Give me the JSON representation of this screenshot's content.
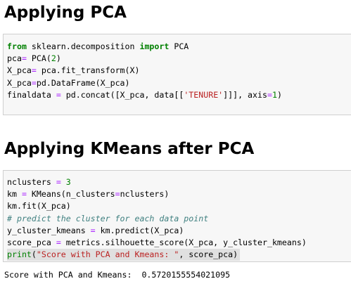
{
  "sections": [
    {
      "heading": "Applying PCA"
    },
    {
      "heading": "Applying KMeans after PCA"
    }
  ],
  "cell1": {
    "line1": {
      "a": "from",
      "b": " sklearn.decomposition ",
      "c": "import",
      "d": " PCA"
    },
    "line2": {
      "a": "pca",
      "b": "=",
      "c": " PCA(",
      "d": "2",
      "e": ")"
    },
    "line3": {
      "a": "X_pca",
      "b": "=",
      "c": " pca.fit_transform(X)"
    },
    "line4": {
      "a": "X_pca",
      "b": "=",
      "c": "pd.DataFrame(X_pca)"
    },
    "line5": {
      "a": "finaldata ",
      "b": "=",
      "c": " pd.concat([X_pca, data[[",
      "d": "'TENURE'",
      "e": "]]], axis",
      "f": "=",
      "g": "1",
      "h": ")"
    }
  },
  "cell2": {
    "line1": {
      "a": "nclusters ",
      "b": "=",
      "c": " ",
      "d": "3"
    },
    "line2": {
      "a": "km ",
      "b": "=",
      "c": " KMeans(n_clusters",
      "d": "=",
      "e": "nclusters)"
    },
    "line3": {
      "a": "km.fit(X_pca)"
    },
    "line4": {
      "a": "# predict the cluster for each data point"
    },
    "line5": {
      "a": "y_cluster_kmeans ",
      "b": "=",
      "c": " km.predict(X_pca)"
    },
    "line6": {
      "a": "score_pca ",
      "b": "=",
      "c": " metrics.silhouette_score(X_pca, y_cluster_kmeans)"
    },
    "line7": {
      "a": "print",
      "b": "(",
      "c": "\"Score with PCA and Kmeans: \"",
      "d": ", score_pca)"
    }
  },
  "output": "Score with PCA and Kmeans:  0.5720155554021095",
  "colors": {
    "keyword": "#008000",
    "operator": "#aa22ff",
    "string": "#ba2121",
    "comment": "#408080",
    "cell_background": "#f7f7f7",
    "highlight": "#e0e0e0"
  }
}
